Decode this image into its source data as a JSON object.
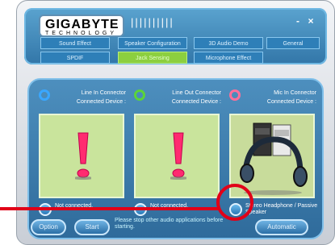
{
  "brand": {
    "name": "GIGABYTE",
    "sub": "TECHNOLOGY"
  },
  "header": {
    "ticks": "||||||||||",
    "minimize": "-",
    "close": "×"
  },
  "tabs": [
    {
      "label": "Sound Effect"
    },
    {
      "label": "Speaker Configuration"
    },
    {
      "label": "3D Audio Demo"
    },
    {
      "label": "General"
    },
    {
      "label": "SPDIF"
    },
    {
      "label": "Jack Sensing",
      "active": true
    },
    {
      "label": "Microphone Effect"
    }
  ],
  "panels": [
    {
      "title": "Line In Connector",
      "subtitle": "Connected Device :",
      "ring_color": "#3aa7ff",
      "status": "Not connected.",
      "icon": "exclamation-icon"
    },
    {
      "title": "Line Out Connector",
      "subtitle": "Connected Device :",
      "ring_color": "#5bd33a",
      "status": "Not connected.",
      "icon": "exclamation-icon"
    },
    {
      "title": "Mic In Connector",
      "subtitle": "Connected Device :",
      "ring_color": "#ff6f9a",
      "status": "Stereo Headphone / Passive Speaker",
      "icon": "speaker-headphone-icon"
    }
  ],
  "buttons": {
    "option": "Option",
    "start": "Start",
    "automatic": "Automatic"
  },
  "message": "Please stop other audio applications before starting.",
  "colors": {
    "accent": "#2e7fb8",
    "active_tab": "#8ccf3f",
    "callout": "#e10018",
    "exclamation": "#ff2b70"
  }
}
